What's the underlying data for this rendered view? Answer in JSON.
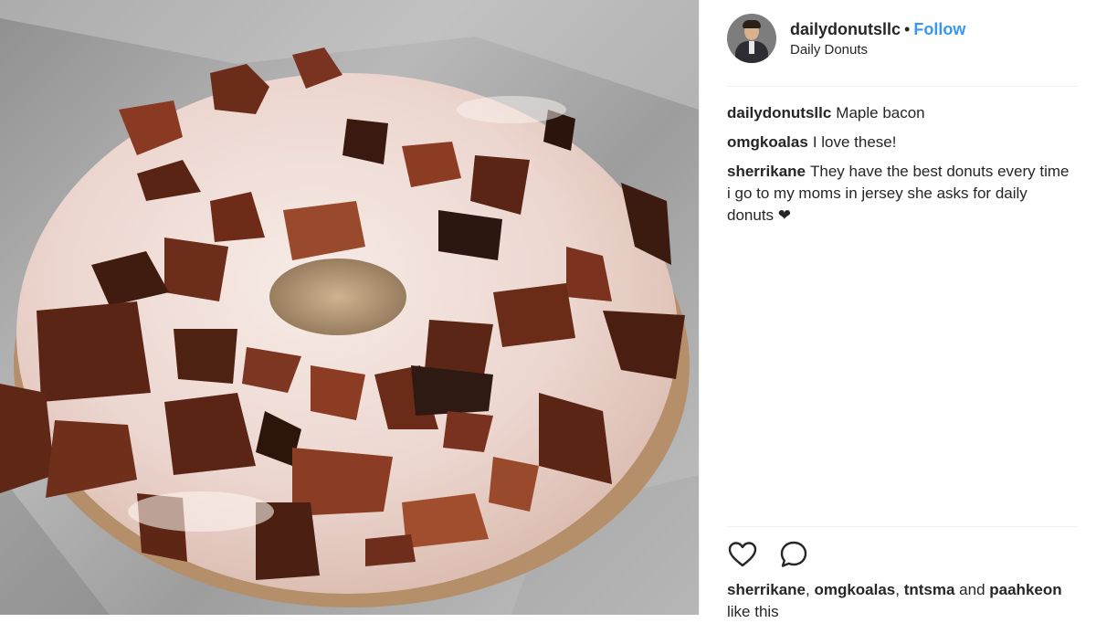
{
  "header": {
    "username": "dailydonutsllc",
    "separator": "•",
    "follow_label": "Follow",
    "location": "Daily Donuts"
  },
  "comments": [
    {
      "user": "dailydonutsllc",
      "text": "Maple bacon"
    },
    {
      "user": "omgkoalas",
      "text": "I love these!"
    },
    {
      "user": "sherrikane",
      "text": "They have the best donuts every time i go to my moms in jersey she asks for daily donuts ❤"
    }
  ],
  "actions": {
    "like_icon": "heart-outline-icon",
    "comment_icon": "speech-bubble-icon"
  },
  "likes": {
    "user1": "sherrikane",
    "sep1": ", ",
    "user2": "omgkoalas",
    "sep2": ", ",
    "user3": "tntsma",
    "and_text": " and ",
    "user4": "paahkeon",
    "suffix": "like this"
  },
  "colors": {
    "follow": "#3897f0",
    "text": "#262626",
    "divider": "#efefef"
  }
}
